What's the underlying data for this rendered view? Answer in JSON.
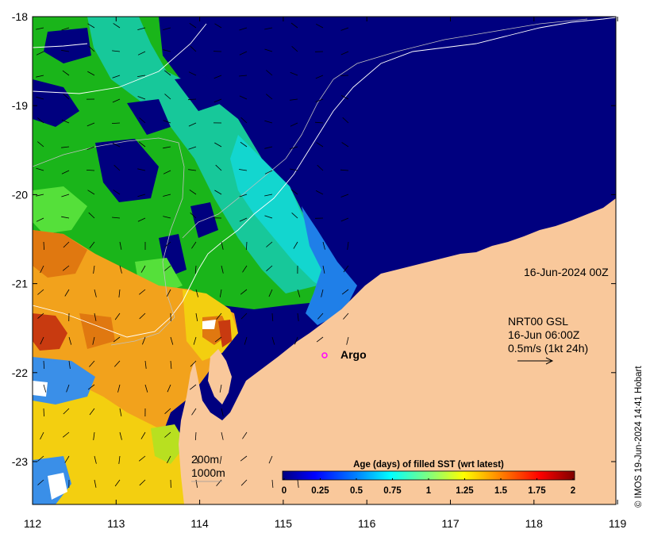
{
  "map": {
    "timestamp": "16-Jun-2024 00Z",
    "current_product": "NRT00 GSL",
    "current_time": "16-Jun 06:00Z",
    "current_scale": "0.5m/s (1kt 24h)",
    "argo_label": "Argo",
    "isobath_200": "200m",
    "isobath_1000": "1000m",
    "credit": "© IMOS 19-Jun-2024 14:41 Hobart",
    "x_ticks": [
      "112",
      "113",
      "114",
      "115",
      "116",
      "117",
      "118",
      "119"
    ],
    "y_ticks": [
      "-18",
      "-19",
      "-20",
      "-21",
      "-22",
      "-23"
    ],
    "colors": {
      "land": "#f9c89b",
      "argo_marker": "#ff00ff"
    }
  },
  "colorbar": {
    "title": "Age (days) of filled SST (wrt latest)",
    "labels": [
      "0",
      "0.25",
      "0.5",
      "0.75",
      "1",
      "1.25",
      "1.5",
      "1.75",
      "2"
    ],
    "range": [
      0,
      2
    ],
    "colors": [
      "#00007f",
      "#0000ff",
      "#007fff",
      "#00ffff",
      "#7fff7f",
      "#ffff00",
      "#ff7f00",
      "#ff0000",
      "#7f0000"
    ]
  }
}
